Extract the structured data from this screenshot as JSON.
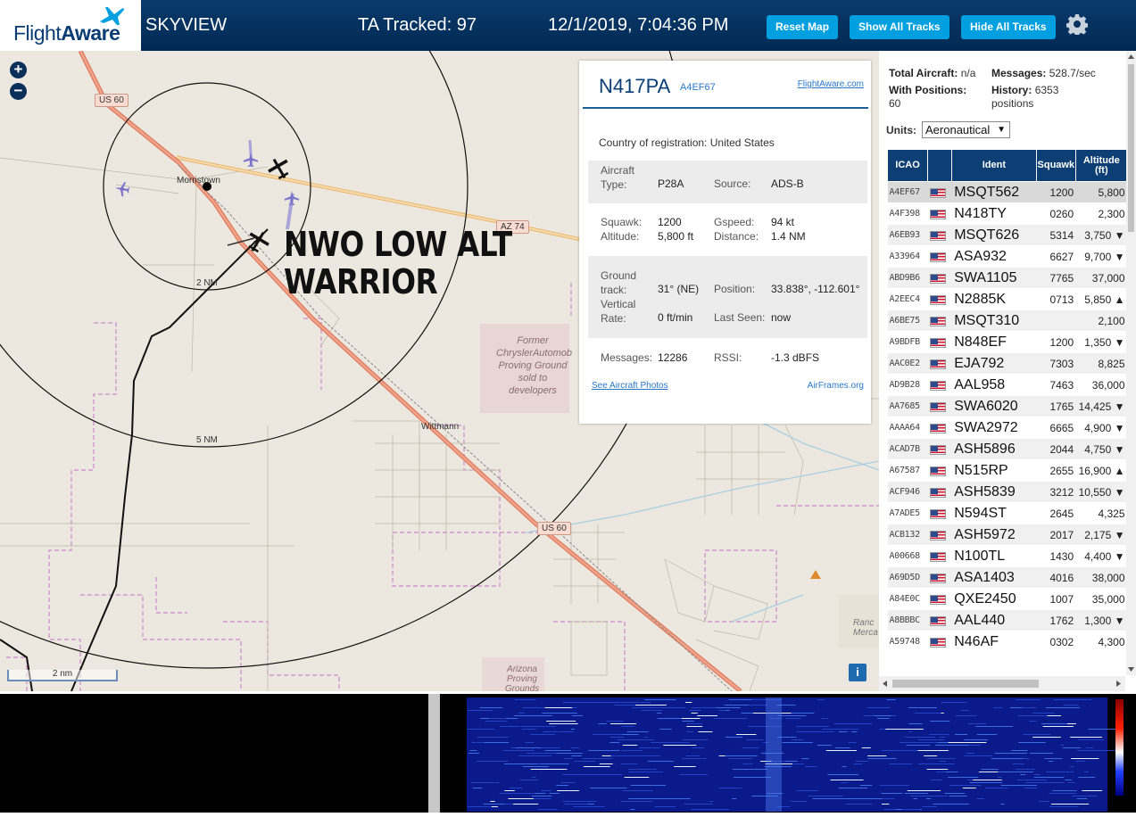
{
  "header": {
    "logo": "FlightAware",
    "logo_flight": "Flight",
    "logo_aware": "Aware",
    "app_name": "SKYVIEW",
    "tracked": "TA Tracked: 97",
    "datetime": "12/1/2019, 7:04:36 PM",
    "buttons": {
      "reset": "Reset Map",
      "show": "Show All Tracks",
      "hide": "Hide All Tracks"
    }
  },
  "map": {
    "zoom_in": "+",
    "zoom_out": "−",
    "labels": {
      "us60_a": "US 60",
      "us60_b": "US 60",
      "az74": "AZ 74",
      "morristown": "Morristown",
      "wittmann": "Wittmann",
      "ring2": "2 NM",
      "ring5": "5 NM",
      "former": "Former ChryslerAutomob Proving Ground sold to developers",
      "arizona": "Arizona Proving Grounds",
      "ranch": "Ranc Merca"
    },
    "annotation": [
      "NWO LOW ALT",
      "WARRIOR"
    ],
    "scale": "2 nm",
    "info": "i"
  },
  "aircraft": {
    "ident": "N417PA",
    "icao": "A4EF67",
    "fa_link": "FlightAware.com",
    "country_label": "Country of registration:",
    "country": "United States",
    "type_label": "Aircraft Type:",
    "type": "P28A",
    "source_label": "Source:",
    "source": "ADS-B",
    "squawk_label": "Squawk:",
    "squawk": "1200",
    "altitude_label": "Altitude:",
    "altitude": "5,800 ft",
    "gspeed_label": "Gspeed:",
    "gspeed": "94 kt",
    "distance_label": "Distance:",
    "distance": "1.4 NM",
    "track_label": "Ground track:",
    "track": "31° (NE)",
    "position_label": "Position:",
    "position": "33.838°, -112.601°",
    "vrate_label": "Vertical Rate:",
    "vrate": "0 ft/min",
    "lastseen_label": "Last Seen:",
    "lastseen": "now",
    "messages_label": "Messages:",
    "messages": "12286",
    "rssi_label": "RSSI:",
    "rssi": "-1.3 dBFS",
    "photos_link": "See Aircraft Photos",
    "airframes_link": "AirFrames.org"
  },
  "sidebar": {
    "total_label": "Total Aircraft:",
    "total": "n/a",
    "messages_label": "Messages:",
    "messages": "528.7/sec",
    "positions_label": "With Positions:",
    "positions": "60",
    "history_label": "History:",
    "history": "6353",
    "history_unit": "positions",
    "units_label": "Units:",
    "units_value": "Aeronautical",
    "columns": [
      "ICAO",
      "",
      "Ident",
      "Squawk",
      "Altitude (ft)"
    ],
    "rows": [
      {
        "icao": "A4EF67",
        "ident": "MSQT562",
        "squawk": "1200",
        "alt": "5,800"
      },
      {
        "icao": "A4F398",
        "ident": "N418TY",
        "squawk": "0260",
        "alt": "2,300"
      },
      {
        "icao": "A6EB93",
        "ident": "MSQT626",
        "squawk": "5314",
        "alt": "3,750 ▼"
      },
      {
        "icao": "A33964",
        "ident": "ASA932",
        "squawk": "6627",
        "alt": "9,700 ▼"
      },
      {
        "icao": "ABD9B6",
        "ident": "SWA1105",
        "squawk": "7765",
        "alt": "37,000"
      },
      {
        "icao": "A2EEC4",
        "ident": "N2885K",
        "squawk": "0713",
        "alt": "5,850 ▲"
      },
      {
        "icao": "A6BE75",
        "ident": "MSQT310",
        "squawk": "",
        "alt": "2,100"
      },
      {
        "icao": "A9BDFB",
        "ident": "N848EF",
        "squawk": "1200",
        "alt": "1,350 ▼"
      },
      {
        "icao": "AAC0E2",
        "ident": "EJA792",
        "squawk": "7303",
        "alt": "8,825"
      },
      {
        "icao": "AD9B28",
        "ident": "AAL958",
        "squawk": "7463",
        "alt": "36,000"
      },
      {
        "icao": "AA7685",
        "ident": "SWA6020",
        "squawk": "1765",
        "alt": "14,425 ▼"
      },
      {
        "icao": "AAAA64",
        "ident": "SWA2972",
        "squawk": "6665",
        "alt": "4,900 ▼"
      },
      {
        "icao": "ACAD7B",
        "ident": "ASH5896",
        "squawk": "2044",
        "alt": "4,750 ▼"
      },
      {
        "icao": "A67587",
        "ident": "N515RP",
        "squawk": "2655",
        "alt": "16,900 ▲"
      },
      {
        "icao": "ACF946",
        "ident": "ASH5839",
        "squawk": "3212",
        "alt": "10,550 ▼"
      },
      {
        "icao": "A7ADE5",
        "ident": "N594ST",
        "squawk": "2645",
        "alt": "4,325"
      },
      {
        "icao": "ACB132",
        "ident": "ASH5972",
        "squawk": "2017",
        "alt": "2,175 ▼"
      },
      {
        "icao": "A00668",
        "ident": "N100TL",
        "squawk": "1430",
        "alt": "4,400 ▼"
      },
      {
        "icao": "A69D5D",
        "ident": "ASA1403",
        "squawk": "4016",
        "alt": "38,000"
      },
      {
        "icao": "A84E0C",
        "ident": "QXE2450",
        "squawk": "1007",
        "alt": "35,000"
      },
      {
        "icao": "A8BBBC",
        "ident": "AAL440",
        "squawk": "1762",
        "alt": "1,300 ▼"
      },
      {
        "icao": "A59748",
        "ident": "N46AF",
        "squawk": "0302",
        "alt": "4,300"
      }
    ]
  },
  "colors": {
    "header_bg": "#002f5d",
    "button": "#00a0e0",
    "table_header": "#0d3f74",
    "map_bg": "#ece8df"
  }
}
